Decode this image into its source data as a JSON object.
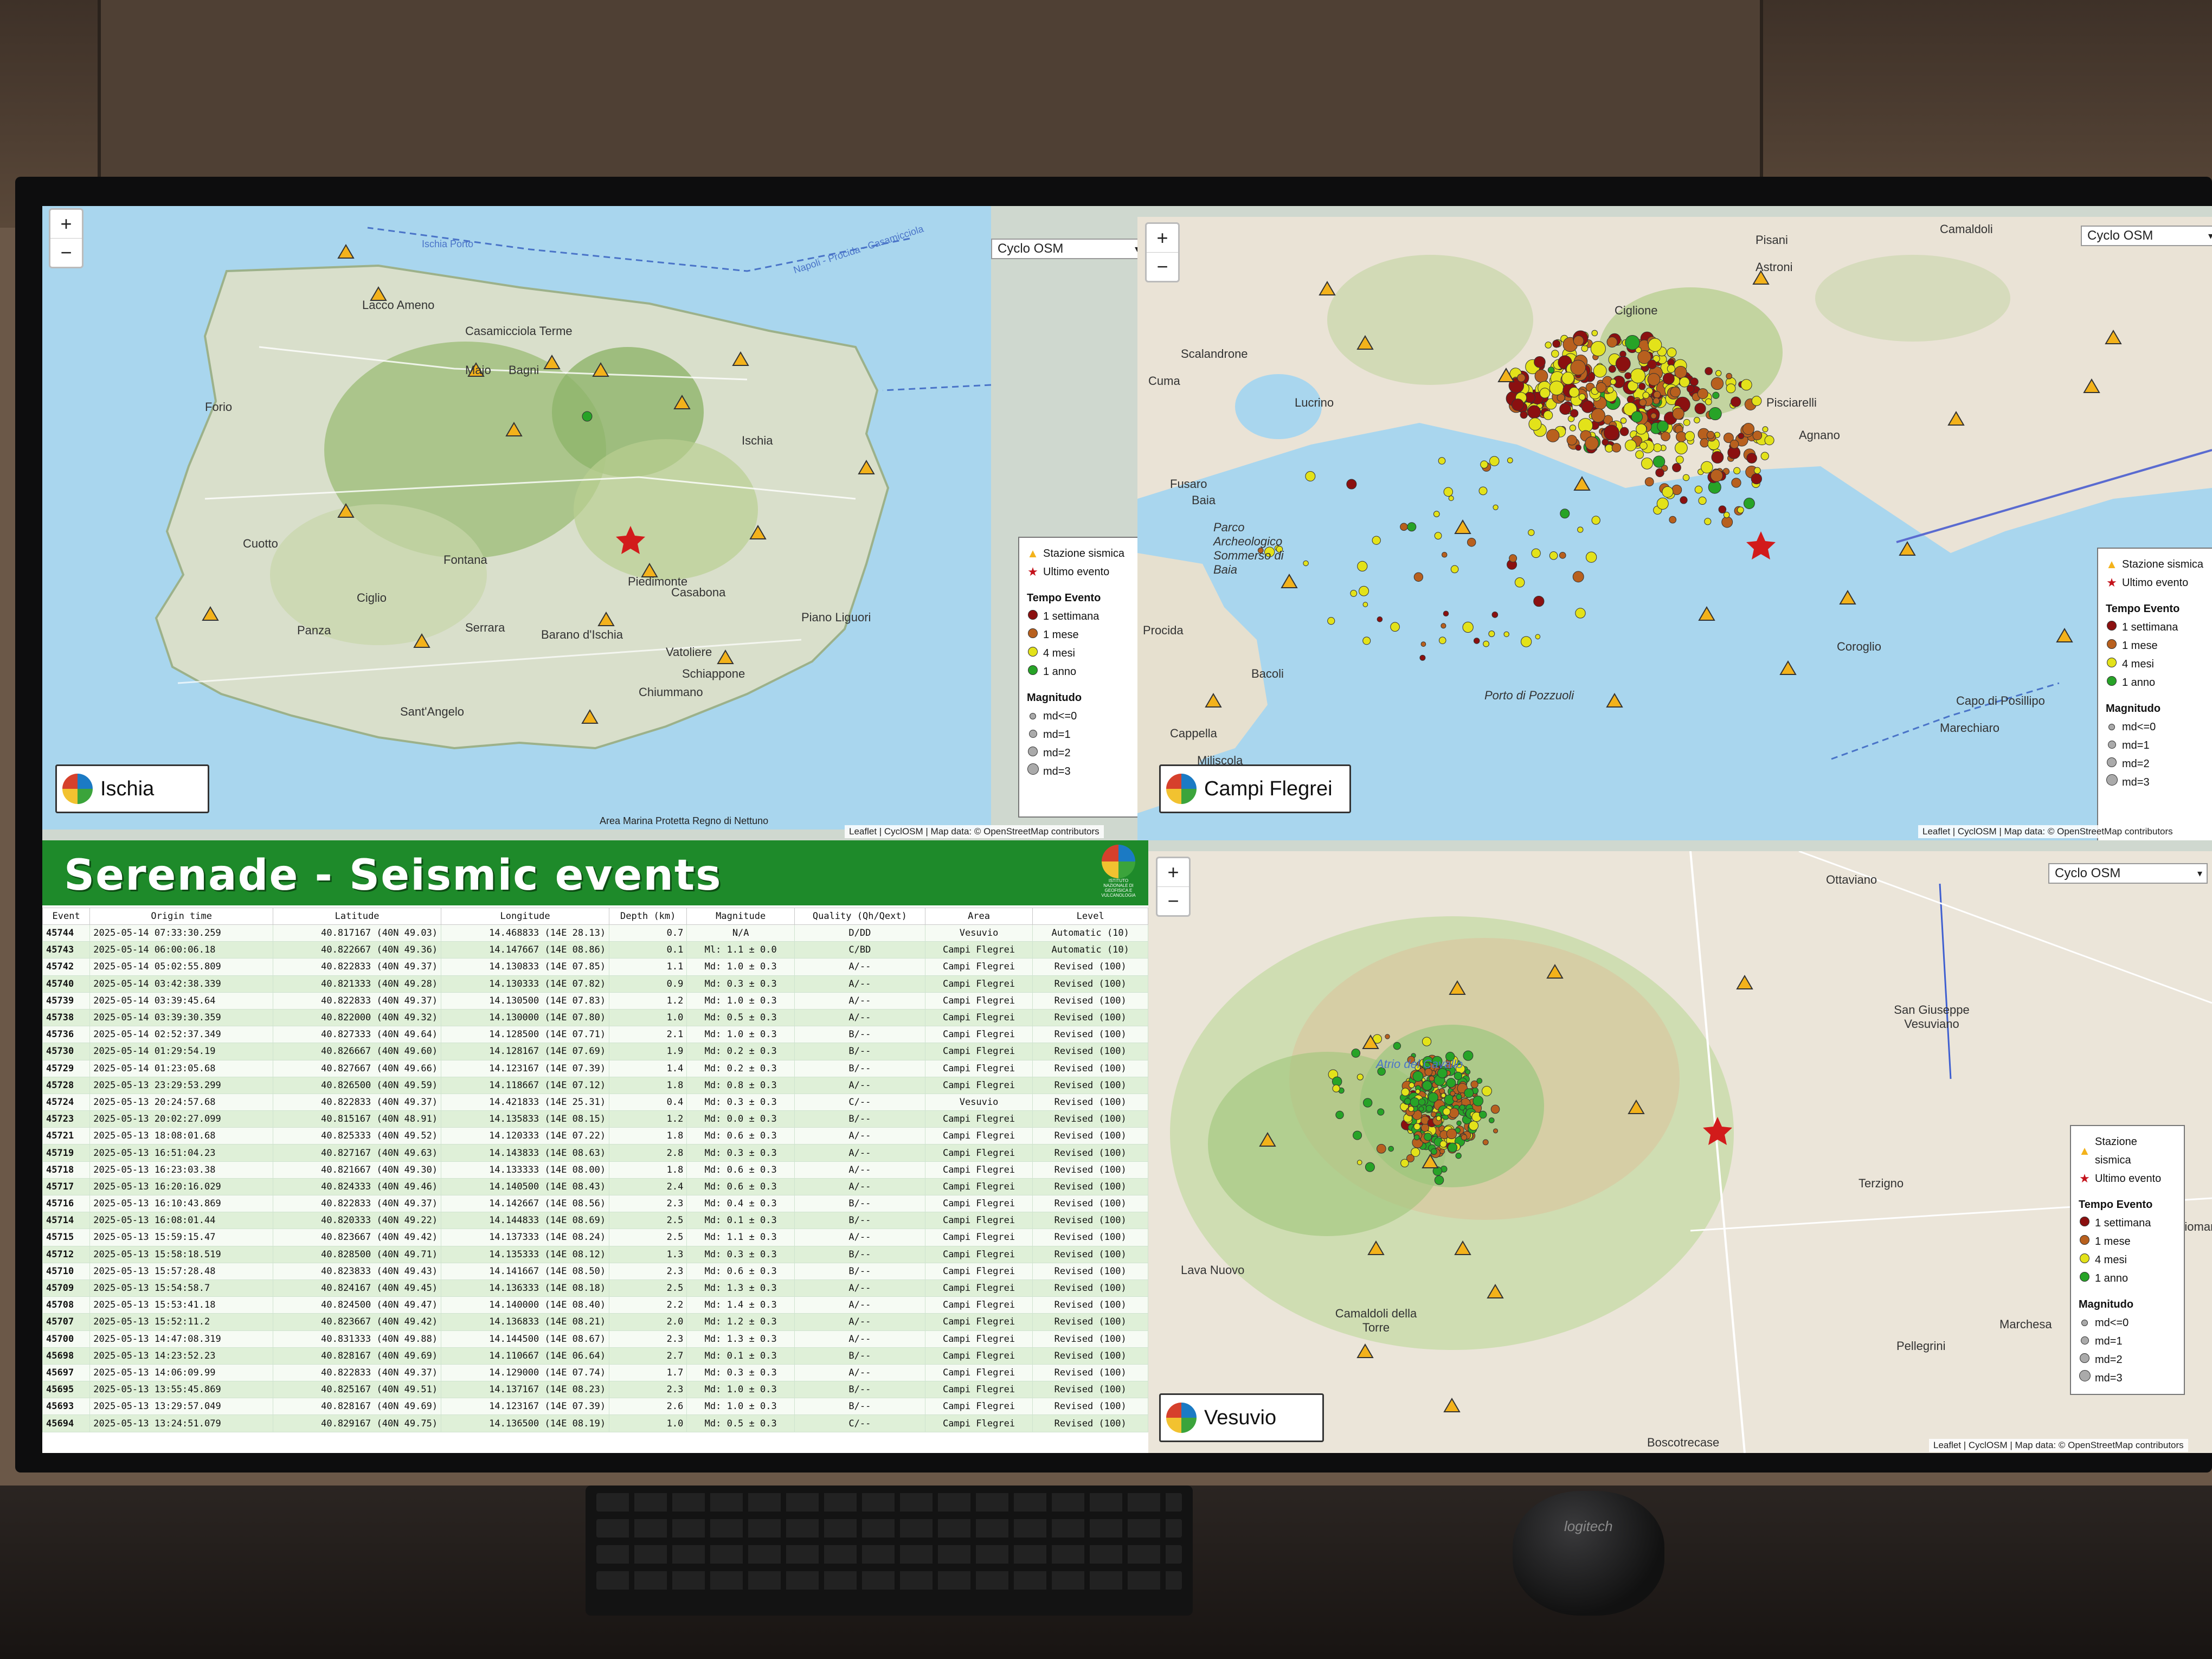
{
  "app": {
    "title": "Serenade - Seismic events",
    "institute_logo_text": "ISTITUTO NAZIONALE DI GEOFISICA E VULCANOLOGIA",
    "zoom_in": "+",
    "zoom_out": "−",
    "layer_option": "Cyclo OSM"
  },
  "legend": {
    "station": "Stazione sismica",
    "last_event": "Ultimo evento",
    "time_header": "Tempo Evento",
    "time_items": [
      {
        "label": "1 settimana",
        "color": "#8b1010"
      },
      {
        "label": "1 mese",
        "color": "#b8601e"
      },
      {
        "label": "4 mesi",
        "color": "#e3e21a"
      },
      {
        "label": "1 anno",
        "color": "#27a327"
      }
    ],
    "magnitude_header": "Magnitudo",
    "magnitude_items": [
      "md<=0",
      "md=1",
      "md=2",
      "md=3"
    ]
  },
  "maps": {
    "ischia": {
      "name": "Ischia",
      "attribution_left": "Area Marina Protetta Regno di Nettuno",
      "attribution": "Leaflet | CyclOSM | Map data: © OpenStreetMap contributors",
      "places": [
        "Ischia Porto",
        "Lacco Ameno",
        "Casamicciola Terme",
        "Majo",
        "Bagni",
        "Forio",
        "Ischia",
        "Cuotto",
        "Fontana",
        "Piedimonte",
        "Ciglio",
        "Serrara",
        "Panza",
        "Barano d'Ischia",
        "Casabona",
        "Piano Liguori",
        "Vatoliere",
        "Schiappone",
        "Chiummano",
        "Sant'Angelo",
        "Napoli - Procida - Casamicciola"
      ]
    },
    "campi_flegrei": {
      "name": "Campi Flegrei",
      "attribution": "Leaflet | CyclOSM | Map data: © OpenStreetMap contributors",
      "places": [
        "Camaldoli",
        "Pisani",
        "Astroni",
        "Scalandrone",
        "Cuma",
        "Lucrino",
        "Ciglione",
        "Pisciarelli",
        "Agnano",
        "Fusaro",
        "Baia",
        "Procida",
        "Bacoli",
        "Cappella",
        "Miliscola",
        "Coroglio",
        "Capo di Posillipo",
        "Marechiaro",
        "Parco Archeologico Sommerso di Baia",
        "Porto di Pozzuoli"
      ]
    },
    "vesuvio": {
      "name": "Vesuvio",
      "attribution": "Leaflet | CyclOSM | Map data: © OpenStreetMap contributors",
      "places": [
        "Ottaviano",
        "San Giuseppe Vesuviano",
        "Terzigno",
        "Poggiomarino",
        "Lava Nuovo",
        "Camaldoli della Torre",
        "Pellegrini",
        "Marchesa",
        "Boscotrecase",
        "Atrio del Cavallo"
      ]
    }
  },
  "table": {
    "headers": [
      "Event",
      "Origin time",
      "Latitude",
      "Longitude",
      "Depth (km)",
      "Magnitude",
      "Quality (Qh/Qext)",
      "Area",
      "Level"
    ],
    "rows": [
      [
        "45744",
        "2025-05-14 07:33:30.259",
        "40.817167 (40N 49.03)",
        "14.468833 (14E 28.13)",
        "0.7",
        "N/A",
        "D/DD",
        "Vesuvio",
        "Automatic (10)"
      ],
      [
        "45743",
        "2025-05-14 06:00:06.18",
        "40.822667 (40N 49.36)",
        "14.147667 (14E 08.86)",
        "0.1",
        "Ml: 1.1 ± 0.0",
        "C/BD",
        "Campi Flegrei",
        "Automatic (10)"
      ],
      [
        "45742",
        "2025-05-14 05:02:55.809",
        "40.822833 (40N 49.37)",
        "14.130833 (14E 07.85)",
        "1.1",
        "Md: 1.0 ± 0.3",
        "A/--",
        "Campi Flegrei",
        "Revised (100)"
      ],
      [
        "45740",
        "2025-05-14 03:42:38.339",
        "40.821333 (40N 49.28)",
        "14.130333 (14E 07.82)",
        "0.9",
        "Md: 0.3 ± 0.3",
        "A/--",
        "Campi Flegrei",
        "Revised (100)"
      ],
      [
        "45739",
        "2025-05-14 03:39:45.64",
        "40.822833 (40N 49.37)",
        "14.130500 (14E 07.83)",
        "1.2",
        "Md: 1.0 ± 0.3",
        "A/--",
        "Campi Flegrei",
        "Revised (100)"
      ],
      [
        "45738",
        "2025-05-14 03:39:30.359",
        "40.822000 (40N 49.32)",
        "14.130000 (14E 07.80)",
        "1.0",
        "Md: 0.5 ± 0.3",
        "A/--",
        "Campi Flegrei",
        "Revised (100)"
      ],
      [
        "45736",
        "2025-05-14 02:52:37.349",
        "40.827333 (40N 49.64)",
        "14.128500 (14E 07.71)",
        "2.1",
        "Md: 1.0 ± 0.3",
        "B/--",
        "Campi Flegrei",
        "Revised (100)"
      ],
      [
        "45730",
        "2025-05-14 01:29:54.19",
        "40.826667 (40N 49.60)",
        "14.128167 (14E 07.69)",
        "1.9",
        "Md: 0.2 ± 0.3",
        "B/--",
        "Campi Flegrei",
        "Revised (100)"
      ],
      [
        "45729",
        "2025-05-14 01:23:05.68",
        "40.827667 (40N 49.66)",
        "14.123167 (14E 07.39)",
        "1.4",
        "Md: 0.2 ± 0.3",
        "B/--",
        "Campi Flegrei",
        "Revised (100)"
      ],
      [
        "45728",
        "2025-05-13 23:29:53.299",
        "40.826500 (40N 49.59)",
        "14.118667 (14E 07.12)",
        "1.8",
        "Md: 0.8 ± 0.3",
        "A/--",
        "Campi Flegrei",
        "Revised (100)"
      ],
      [
        "45724",
        "2025-05-13 20:24:57.68",
        "40.822833 (40N 49.37)",
        "14.421833 (14E 25.31)",
        "0.4",
        "Md: 0.3 ± 0.3",
        "C/--",
        "Vesuvio",
        "Revised (100)"
      ],
      [
        "45723",
        "2025-05-13 20:02:27.099",
        "40.815167 (40N 48.91)",
        "14.135833 (14E 08.15)",
        "1.2",
        "Md: 0.0 ± 0.3",
        "B/--",
        "Campi Flegrei",
        "Revised (100)"
      ],
      [
        "45721",
        "2025-05-13 18:08:01.68",
        "40.825333 (40N 49.52)",
        "14.120333 (14E 07.22)",
        "1.8",
        "Md: 0.6 ± 0.3",
        "A/--",
        "Campi Flegrei",
        "Revised (100)"
      ],
      [
        "45719",
        "2025-05-13 16:51:04.23",
        "40.827167 (40N 49.63)",
        "14.143833 (14E 08.63)",
        "2.8",
        "Md: 0.3 ± 0.3",
        "A/--",
        "Campi Flegrei",
        "Revised (100)"
      ],
      [
        "45718",
        "2025-05-13 16:23:03.38",
        "40.821667 (40N 49.30)",
        "14.133333 (14E 08.00)",
        "1.8",
        "Md: 0.6 ± 0.3",
        "A/--",
        "Campi Flegrei",
        "Revised (100)"
      ],
      [
        "45717",
        "2025-05-13 16:20:16.029",
        "40.824333 (40N 49.46)",
        "14.140500 (14E 08.43)",
        "2.4",
        "Md: 0.6 ± 0.3",
        "A/--",
        "Campi Flegrei",
        "Revised (100)"
      ],
      [
        "45716",
        "2025-05-13 16:10:43.869",
        "40.822833 (40N 49.37)",
        "14.142667 (14E 08.56)",
        "2.3",
        "Md: 0.4 ± 0.3",
        "B/--",
        "Campi Flegrei",
        "Revised (100)"
      ],
      [
        "45714",
        "2025-05-13 16:08:01.44",
        "40.820333 (40N 49.22)",
        "14.144833 (14E 08.69)",
        "2.5",
        "Md: 0.1 ± 0.3",
        "B/--",
        "Campi Flegrei",
        "Revised (100)"
      ],
      [
        "45715",
        "2025-05-13 15:59:15.47",
        "40.823667 (40N 49.42)",
        "14.137333 (14E 08.24)",
        "2.5",
        "Md: 1.1 ± 0.3",
        "A/--",
        "Campi Flegrei",
        "Revised (100)"
      ],
      [
        "45712",
        "2025-05-13 15:58:18.519",
        "40.828500 (40N 49.71)",
        "14.135333 (14E 08.12)",
        "1.3",
        "Md: 0.3 ± 0.3",
        "B/--",
        "Campi Flegrei",
        "Revised (100)"
      ],
      [
        "45710",
        "2025-05-13 15:57:28.48",
        "40.823833 (40N 49.43)",
        "14.141667 (14E 08.50)",
        "2.3",
        "Md: 0.6 ± 0.3",
        "B/--",
        "Campi Flegrei",
        "Revised (100)"
      ],
      [
        "45709",
        "2025-05-13 15:54:58.7",
        "40.824167 (40N 49.45)",
        "14.136333 (14E 08.18)",
        "2.5",
        "Md: 1.3 ± 0.3",
        "A/--",
        "Campi Flegrei",
        "Revised (100)"
      ],
      [
        "45708",
        "2025-05-13 15:53:41.18",
        "40.824500 (40N 49.47)",
        "14.140000 (14E 08.40)",
        "2.2",
        "Md: 1.4 ± 0.3",
        "A/--",
        "Campi Flegrei",
        "Revised (100)"
      ],
      [
        "45707",
        "2025-05-13 15:52:11.2",
        "40.823667 (40N 49.42)",
        "14.136833 (14E 08.21)",
        "2.0",
        "Md: 1.2 ± 0.3",
        "A/--",
        "Campi Flegrei",
        "Revised (100)"
      ],
      [
        "45700",
        "2025-05-13 14:47:08.319",
        "40.831333 (40N 49.88)",
        "14.144500 (14E 08.67)",
        "2.3",
        "Md: 1.3 ± 0.3",
        "A/--",
        "Campi Flegrei",
        "Revised (100)"
      ],
      [
        "45698",
        "2025-05-13 14:23:52.23",
        "40.828167 (40N 49.69)",
        "14.110667 (14E 06.64)",
        "2.7",
        "Md: 0.1 ± 0.3",
        "B/--",
        "Campi Flegrei",
        "Revised (100)"
      ],
      [
        "45697",
        "2025-05-13 14:06:09.99",
        "40.822833 (40N 49.37)",
        "14.129000 (14E 07.74)",
        "1.7",
        "Md: 0.3 ± 0.3",
        "A/--",
        "Campi Flegrei",
        "Revised (100)"
      ],
      [
        "45695",
        "2025-05-13 13:55:45.869",
        "40.825167 (40N 49.51)",
        "14.137167 (14E 08.23)",
        "2.3",
        "Md: 1.0 ± 0.3",
        "B/--",
        "Campi Flegrei",
        "Revised (100)"
      ],
      [
        "45693",
        "2025-05-13 13:29:57.049",
        "40.828167 (40N 49.69)",
        "14.123167 (14E 07.39)",
        "2.6",
        "Md: 1.0 ± 0.3",
        "B/--",
        "Campi Flegrei",
        "Revised (100)"
      ],
      [
        "45694",
        "2025-05-13 13:24:51.079",
        "40.829167 (40N 49.75)",
        "14.136500 (14E 08.19)",
        "1.0",
        "Md: 0.5 ± 0.3",
        "C/--",
        "Campi Flegrei",
        "Revised (100)"
      ]
    ]
  }
}
